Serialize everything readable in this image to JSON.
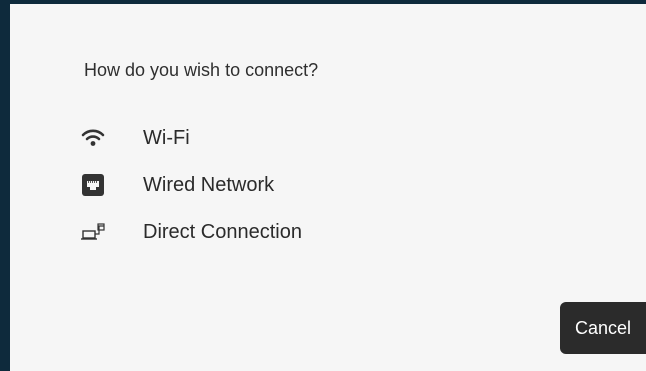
{
  "dialog": {
    "prompt": "How do you wish to connect?",
    "options": [
      {
        "label": "Wi-Fi",
        "icon": "wifi-icon"
      },
      {
        "label": "Wired Network",
        "icon": "ethernet-icon"
      },
      {
        "label": "Direct Connection",
        "icon": "direct-connection-icon"
      }
    ],
    "cancel_label": "Cancel"
  },
  "colors": {
    "background": "#0e2a3c",
    "dialog_background": "#f6f6f6",
    "text": "#2b2b2b",
    "button_background": "#2b2b2b",
    "button_text": "#ffffff"
  }
}
